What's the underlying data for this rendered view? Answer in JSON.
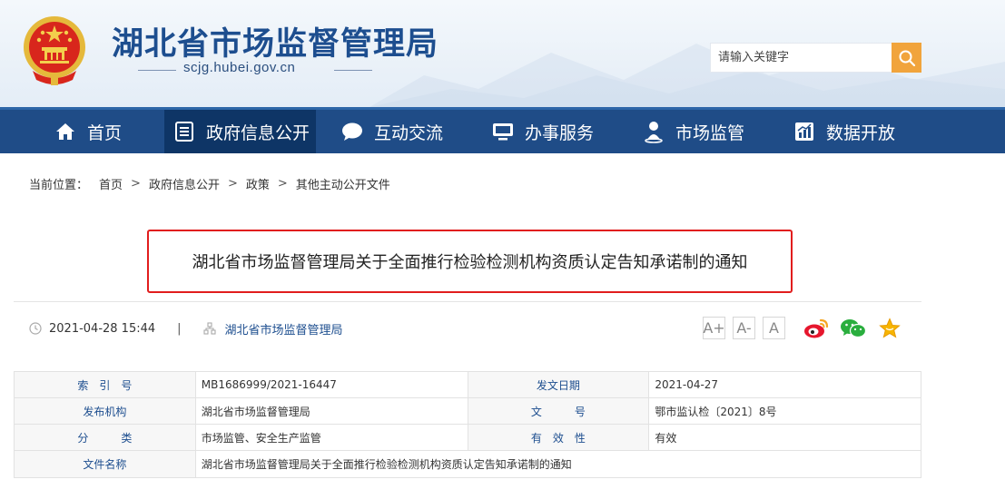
{
  "header": {
    "site_title": "湖北省市场监督管理局",
    "site_url": "scjg.hubei.gov.cn",
    "emblem_icon": "national-emblem-icon",
    "search": {
      "placeholder": "请输入关键字",
      "value": "",
      "button_icon": "search-icon",
      "button_color": "#f1a43c"
    }
  },
  "nav": {
    "bg_color": "#1f4c87",
    "active_color": "#0e3566",
    "items": [
      {
        "label": "首页",
        "icon": "home-icon"
      },
      {
        "label": "政府信息公开",
        "icon": "document-list-icon",
        "active": true
      },
      {
        "label": "互动交流",
        "icon": "chat-bubble-icon"
      },
      {
        "label": "办事服务",
        "icon": "monitor-icon"
      },
      {
        "label": "市场监管",
        "icon": "location-person-icon"
      },
      {
        "label": "数据开放",
        "icon": "bar-chart-icon"
      }
    ]
  },
  "breadcrumb": {
    "prefix": "当前位置：",
    "separator": ">",
    "items": [
      "首页",
      "政府信息公开",
      "政策",
      "其他主动公开文件"
    ]
  },
  "article": {
    "title": "湖北省市场监督管理局关于全面推行检验检测机构资质认定告知承诺制的通知",
    "highlight_color": "#e11d1d",
    "datetime": "2021-04-28 15:44",
    "separator": "|",
    "publisher": "湖北省市场监督管理局",
    "font_controls": [
      "A+",
      "A-",
      "A"
    ],
    "share_icons": [
      "weibo-icon",
      "wechat-icon",
      "favorite-star-icon"
    ]
  },
  "info_table": {
    "rows": [
      {
        "label1": "索　引　号",
        "value1": "MB1686999/2021-16447",
        "label2": "发文日期",
        "value2": "2021-04-27"
      },
      {
        "label1": "发布机构",
        "value1": "湖北省市场监督管理局",
        "label2": "文　　　号",
        "value2": "鄂市监认检〔2021〕8号"
      },
      {
        "label1": "分　　　类",
        "value1": "市场监管、安全生产监管",
        "label2": "有　效　性",
        "value2": "有效"
      }
    ],
    "file_name_label": "文件名称",
    "file_name_value": "湖北省市场监督管理局关于全面推行检验检测机构资质认定告知承诺制的通知"
  }
}
